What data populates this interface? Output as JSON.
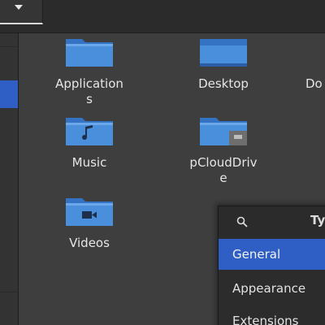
{
  "header": {
    "dropdown_icon": "chevron-down-icon"
  },
  "files": [
    {
      "name": "Applications",
      "label_lines": "Application\ns",
      "icon": "folder-icon"
    },
    {
      "name": "Desktop",
      "icon": "desktop-folder-icon"
    },
    {
      "name": "Do",
      "icon": "folder-icon"
    },
    {
      "name": "Music",
      "icon": "music-folder-icon"
    },
    {
      "name": "pCloudDrive",
      "icon": "remote-folder-icon"
    },
    {
      "name": "Videos",
      "icon": "video-folder-icon"
    }
  ],
  "labels": {
    "applications": "Application",
    "applications_wrap": "s",
    "desktop": "Desktop",
    "partial": "Do",
    "music": "Music",
    "pcloud": "pCloudDriv",
    "pcloud_wrap": "e",
    "videos": "Videos"
  },
  "popover": {
    "search_icon": "search-icon",
    "search_hint": "Ty",
    "items": [
      {
        "label": "General",
        "active": true
      },
      {
        "label": "Appearance",
        "active": false
      },
      {
        "label": "Extensions",
        "active": false
      }
    ]
  },
  "colors": {
    "accent": "#2f5fc4",
    "folder": "#4a8fdc",
    "folder_dark": "#3473c4",
    "background": "#3e3e3e"
  }
}
